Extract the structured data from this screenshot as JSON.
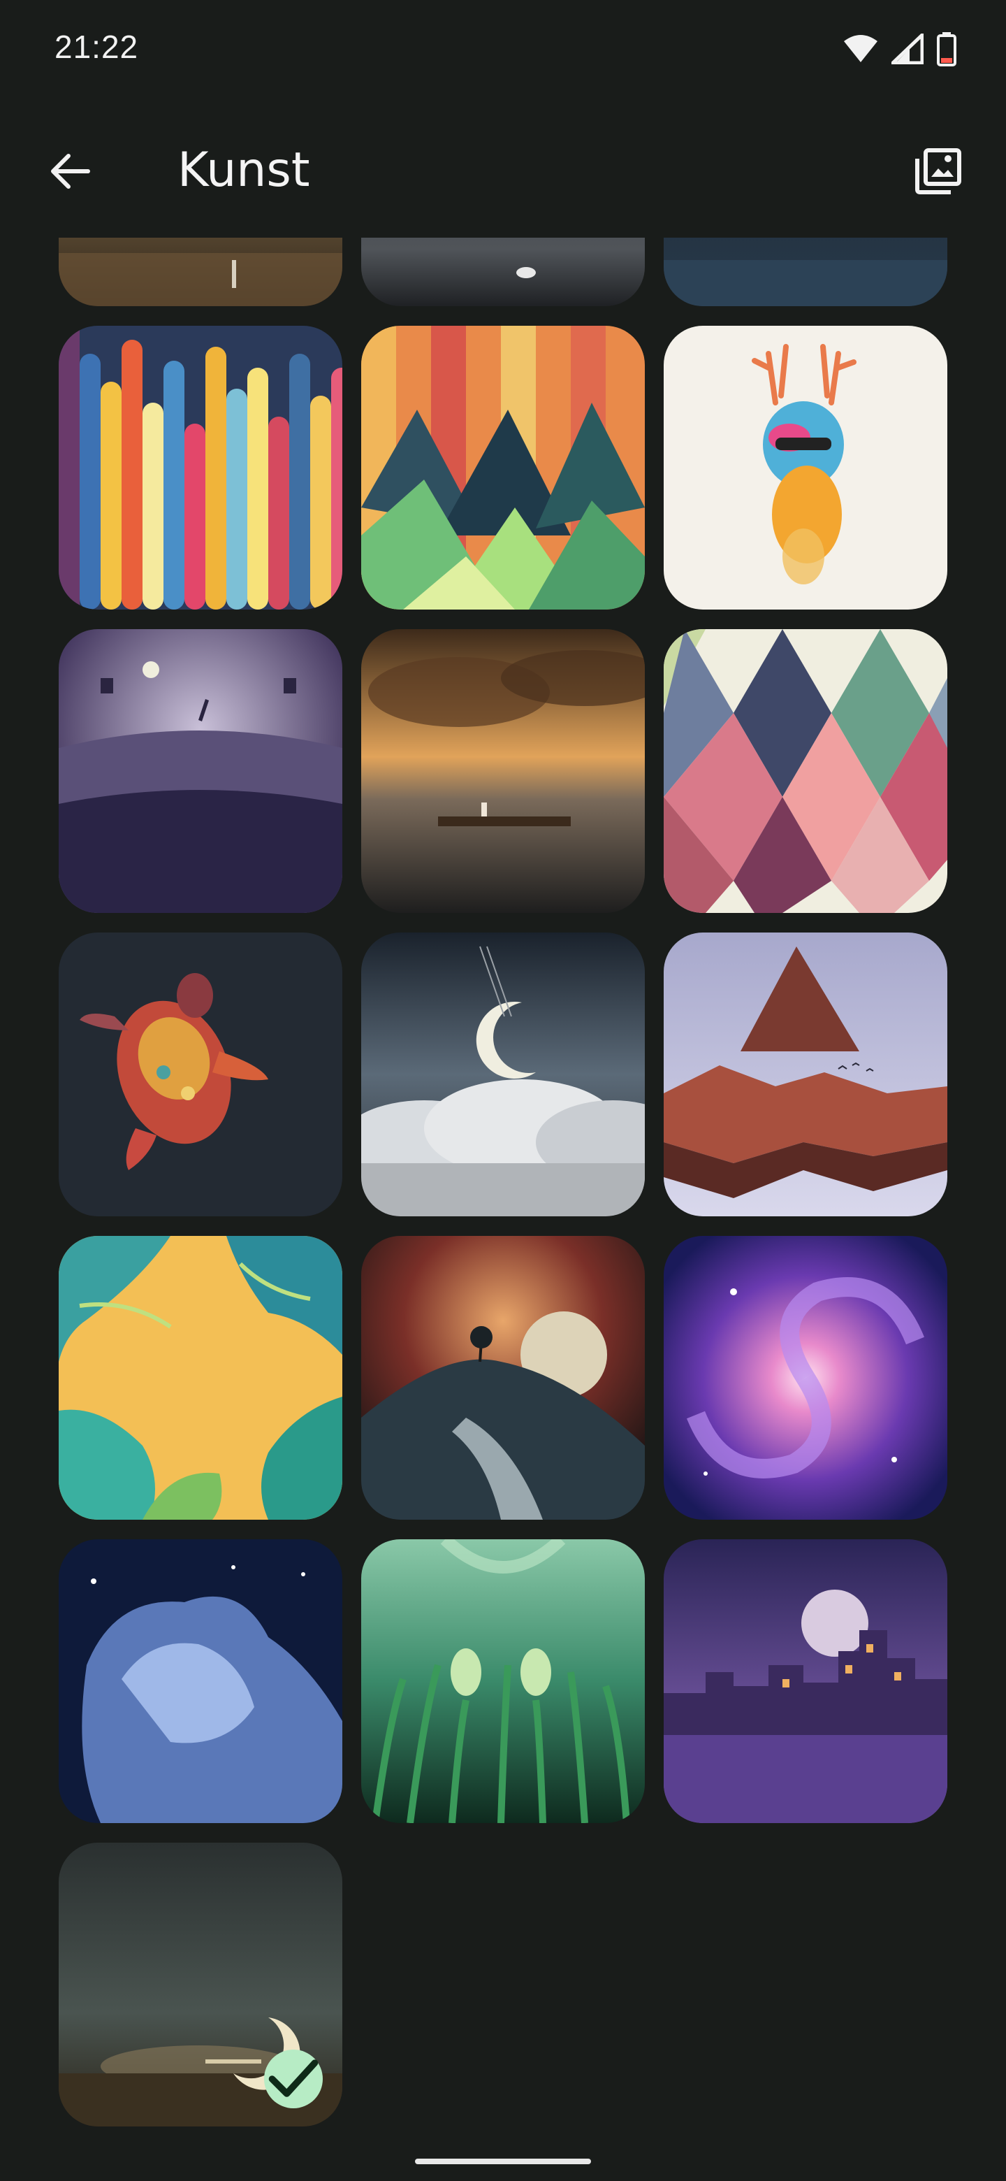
{
  "status_bar": {
    "time": "21:22",
    "icons": [
      "wifi-icon",
      "signal-icon",
      "battery-icon"
    ]
  },
  "app_bar": {
    "title": "Kunst",
    "back_icon": "arrow-back-icon",
    "action_icon": "image-picker-icon"
  },
  "colors": {
    "background": "#191c1a",
    "check_badge": "#b7ecc5"
  },
  "wallpapers": [
    {
      "name": "girl-in-field",
      "selected": false
    },
    {
      "name": "white-horse-dark",
      "selected": false
    },
    {
      "name": "dark-sea",
      "selected": false
    },
    {
      "name": "colorful-stripes",
      "selected": false
    },
    {
      "name": "geometric-mountains",
      "selected": false
    },
    {
      "name": "watercolor-deer",
      "selected": false
    },
    {
      "name": "giraffe-moon-field",
      "selected": false
    },
    {
      "name": "raft-on-sea",
      "selected": false
    },
    {
      "name": "harlequin-diamonds",
      "selected": false
    },
    {
      "name": "mosaic-turtle",
      "selected": false
    },
    {
      "name": "moon-swing-clouds",
      "selected": false
    },
    {
      "name": "mountain-triangle",
      "selected": false
    },
    {
      "name": "banana-leaves",
      "selected": false
    },
    {
      "name": "tree-on-hill-moon",
      "selected": false
    },
    {
      "name": "spiral-galaxy",
      "selected": false
    },
    {
      "name": "horsehead-nebula",
      "selected": false
    },
    {
      "name": "green-plants",
      "selected": false
    },
    {
      "name": "night-city-moon",
      "selected": false
    },
    {
      "name": "crescent-moon-meadow",
      "selected": true
    }
  ]
}
